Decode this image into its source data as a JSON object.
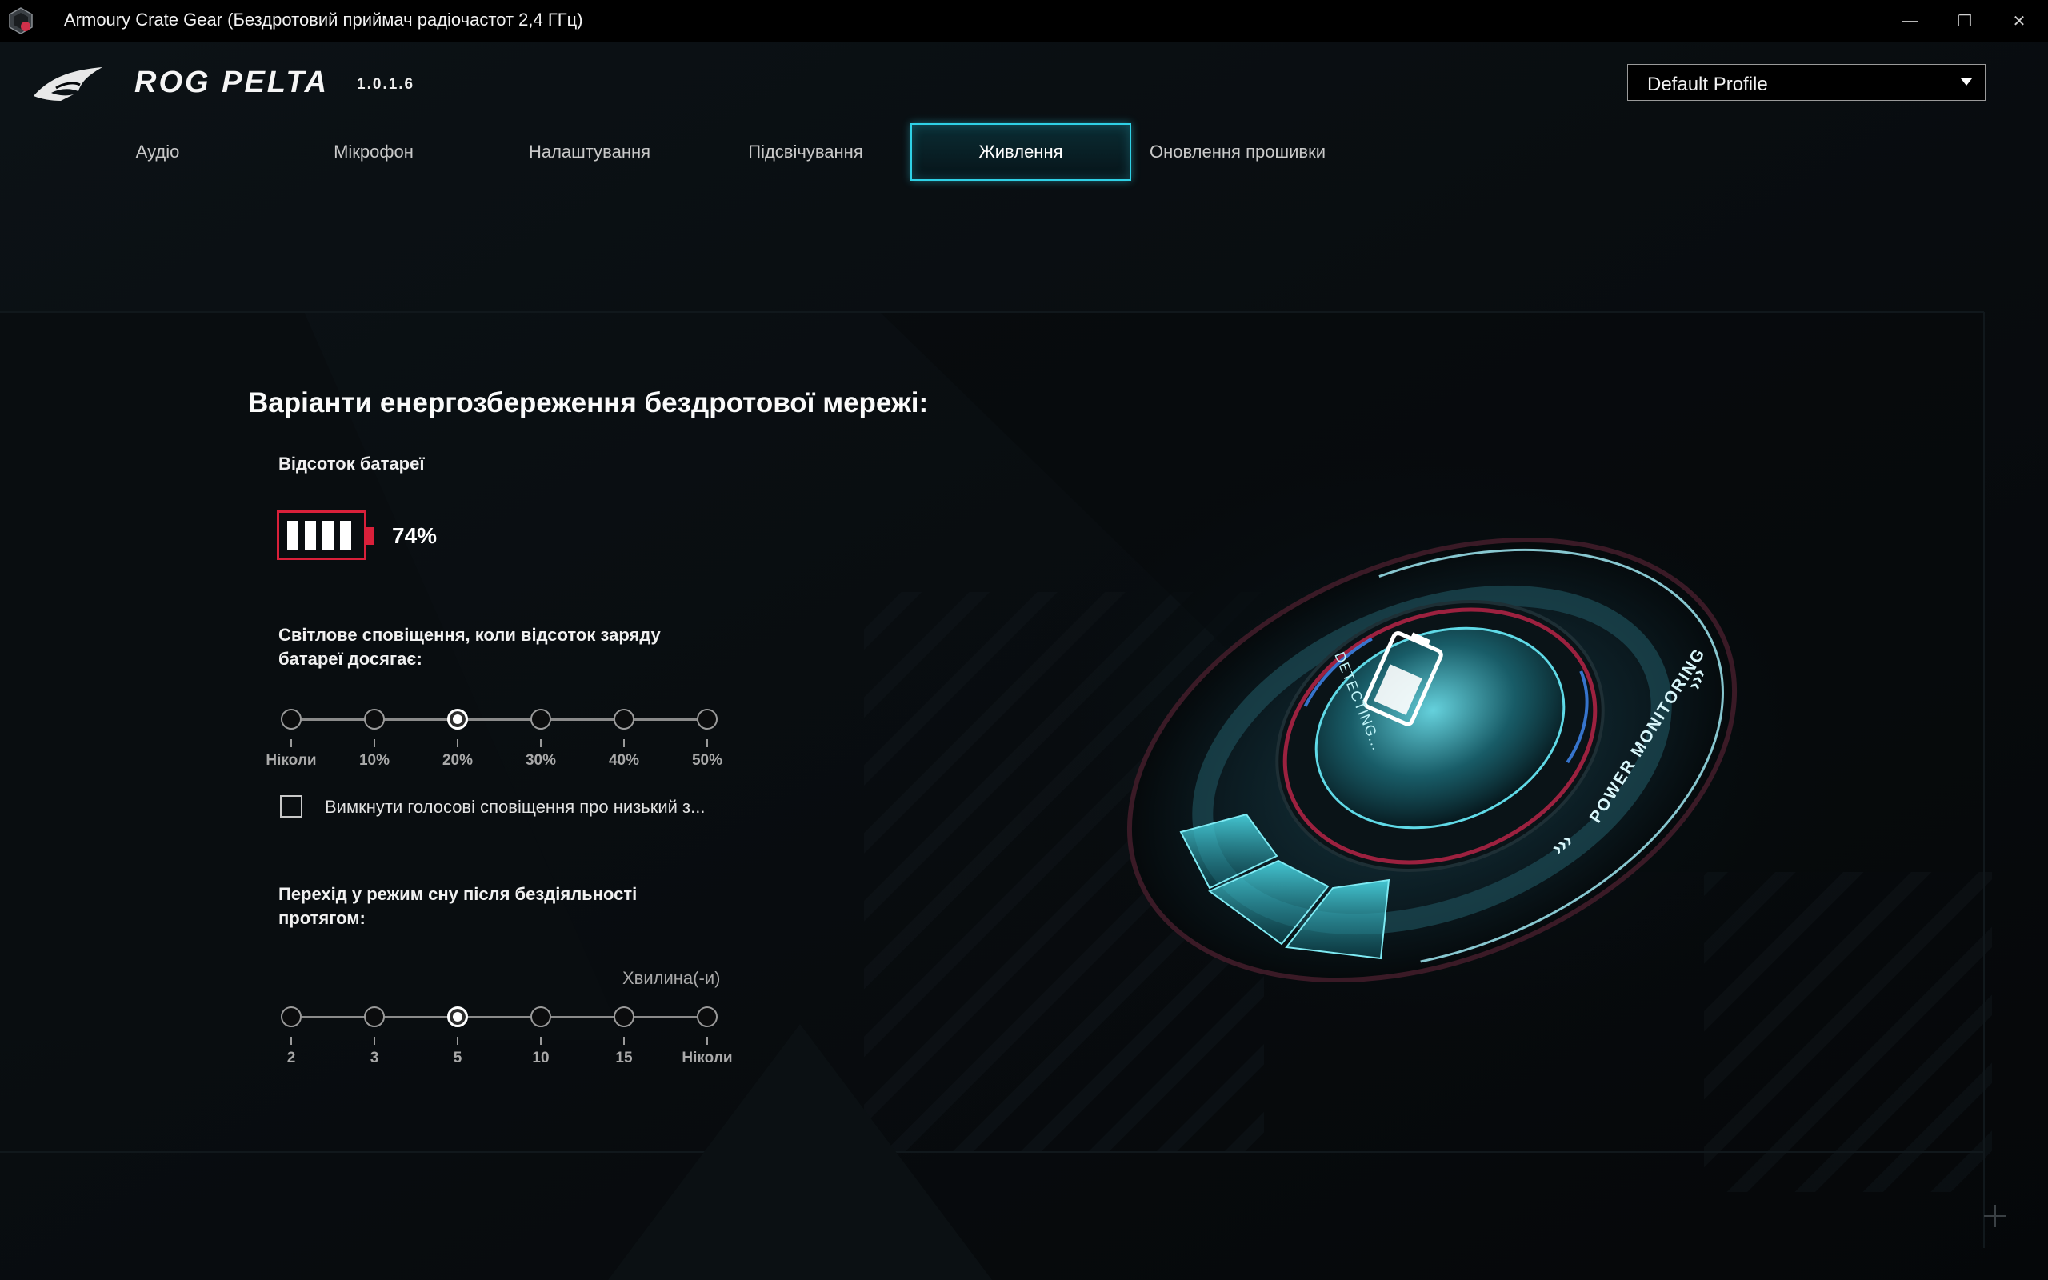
{
  "window": {
    "title": "Armoury Crate Gear (Бездротовий приймач радіочастот 2,4 ГГц)",
    "controls": {
      "minimize": "—",
      "restore": "❐",
      "close": "✕"
    }
  },
  "header": {
    "product": "ROG PELTA",
    "version": "1.0.1.6",
    "profile": {
      "selected": "Default Profile",
      "options": [
        "Default Profile"
      ]
    }
  },
  "tabs": [
    {
      "label": "Аудіо",
      "active": false
    },
    {
      "label": "Мікрофон",
      "active": false
    },
    {
      "label": "Налаштування",
      "active": false
    },
    {
      "label": "Підсвічування",
      "active": false
    },
    {
      "label": "Живлення",
      "active": true
    },
    {
      "label": "Оновлення прошивки",
      "active": false
    }
  ],
  "main": {
    "section_title": "Варіанти енергозбереження бездротової мережі:",
    "battery": {
      "label": "Відсоток батареї",
      "percent": 74,
      "percent_text": "74%",
      "cells_lit": 4
    },
    "light_notification": {
      "label_line1": "Світлове сповіщення, коли відсоток заряду",
      "label_line2": "батареї досягає:",
      "options": [
        "Ніколи",
        "10%",
        "20%",
        "30%",
        "40%",
        "50%"
      ],
      "selected_index": 2
    },
    "voice_checkbox": {
      "label": "Вимкнути голосові сповіщення про низький з...",
      "checked": false
    },
    "sleep": {
      "label_line1": "Перехід у режим сну після бездіяльності",
      "label_line2": "протягом:",
      "unit": "Хвилина(-и)",
      "options": [
        "2",
        "3",
        "5",
        "10",
        "15",
        "Ніколи"
      ],
      "selected_index": 2
    }
  },
  "illustration": {
    "ring_text": "POWER MONITORING",
    "screen_text": "DETECTING...",
    "arrows": "›››"
  },
  "colors": {
    "accent": "#2fd1e6",
    "battery_frame": "#d9203a",
    "background": "#050709",
    "title_bar": "#000000"
  },
  "icons": [
    "rog-eye-logo",
    "armoury-crate-app-icon",
    "dropdown-caret",
    "battery-icon"
  ]
}
